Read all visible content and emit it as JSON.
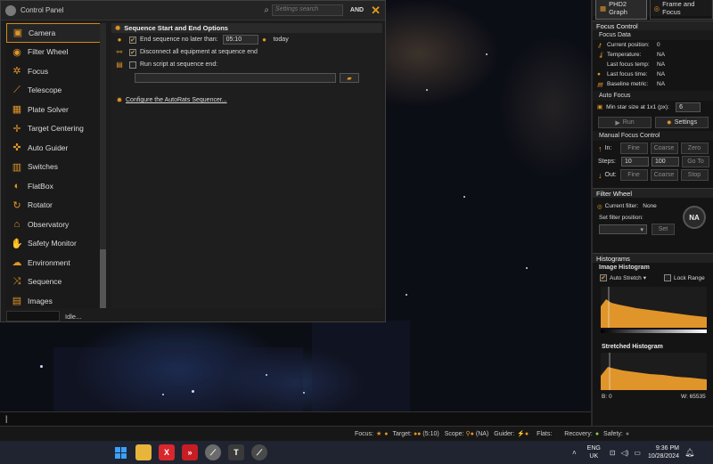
{
  "control_panel": {
    "title": "Control Panel",
    "search_placeholder": "Settings search",
    "and_label": "AND",
    "close_glyph": "✕",
    "sidebar": [
      {
        "label": "Camera",
        "icon": "camera-icon",
        "selected": true
      },
      {
        "label": "Filter Wheel",
        "icon": "filter-wheel-icon"
      },
      {
        "label": "Focus",
        "icon": "focus-icon"
      },
      {
        "label": "Telescope",
        "icon": "telescope-icon"
      },
      {
        "label": "Plate Solver",
        "icon": "plate-solver-icon"
      },
      {
        "label": "Target Centering",
        "icon": "target-centering-icon"
      },
      {
        "label": "Auto Guider",
        "icon": "auto-guider-icon"
      },
      {
        "label": "Switches",
        "icon": "switches-icon"
      },
      {
        "label": "FlatBox",
        "icon": "flatbox-icon"
      },
      {
        "label": "Rotator",
        "icon": "rotator-icon"
      },
      {
        "label": "Observatory",
        "icon": "observatory-icon"
      },
      {
        "label": "Safety Monitor",
        "icon": "safety-monitor-icon"
      },
      {
        "label": "Environment",
        "icon": "environment-icon"
      },
      {
        "label": "Sequence",
        "icon": "sequence-icon"
      },
      {
        "label": "Images",
        "icon": "images-icon"
      }
    ],
    "section_title": "Sequence Start and End Options",
    "end_sequence_label": "End sequence no later than:",
    "end_sequence_time": "05:10",
    "today_label": "today",
    "disconnect_label": "Disconnect all equipment at sequence end",
    "run_script_label": "Run script at sequence end:",
    "autorats_link": "Configure the AutoRats Sequencer...",
    "status_text": "Idle..."
  },
  "right_panel": {
    "tabs": [
      "PHD2 Graph",
      "Frame and Focus"
    ],
    "focus_control": {
      "title": "Focus Control",
      "focus_data_title": "Focus Data",
      "rows": [
        {
          "k": "Current position:",
          "v": "0"
        },
        {
          "k": "Temperature:",
          "v": "NA"
        },
        {
          "k": "Last focus temp:",
          "v": "NA"
        },
        {
          "k": "Last focus time:",
          "v": "NA"
        },
        {
          "k": "Baseline metric:",
          "v": "NA"
        }
      ],
      "auto_focus_title": "Auto Focus",
      "min_star_label": "Min star size at 1x1 (px):",
      "min_star_value": "6",
      "run_label": "Run",
      "settings_label": "Settings",
      "manual_title": "Manual Focus Control",
      "in_label": "In:",
      "out_label": "Out:",
      "steps_label": "Steps:",
      "steps_fine": "10",
      "steps_coarse": "100",
      "fine_label": "Fine",
      "coarse_label": "Coarse",
      "zero_label": "Zero",
      "goto_label": "Go To",
      "stop_label": "Stop"
    },
    "filter_wheel": {
      "title": "Filter Wheel",
      "current_label": "Current filter:",
      "current_value": "None",
      "set_label": "Set filter position:",
      "set_button": "Set",
      "badge": "NA"
    },
    "histograms": {
      "title": "Histograms",
      "image_title": "Image Histogram",
      "auto_stretch": "Auto Stretch",
      "lock_range": "Lock Range",
      "stretched_title": "Stretched Histogram",
      "b_label": "B: 0",
      "w_label": "W: 65535"
    }
  },
  "status_bar": {
    "focus": "Focus:",
    "target": "Target:",
    "target_val": "(5:10)",
    "scope": "Scope:",
    "scope_val": "(NA)",
    "guider": "Guider:",
    "flats": "Flats:",
    "recovery": "Recovery:",
    "safety": "Safety:"
  },
  "taskbar": {
    "lang_top": "ENG",
    "lang_bottom": "UK",
    "time": "9:36 PM",
    "date": "10/28/2024"
  },
  "colors": {
    "accent": "#e0952a",
    "background": "#1c1c1c"
  }
}
